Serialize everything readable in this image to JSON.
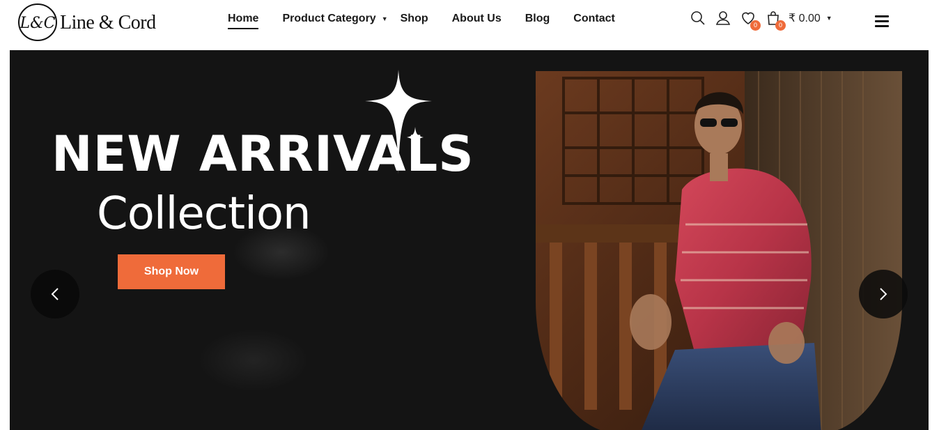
{
  "brand": {
    "logo_monogram": "L&C",
    "name": "Line & Cord"
  },
  "nav": {
    "items": [
      {
        "label": "Home",
        "active": true
      },
      {
        "label": "Product Category",
        "has_dropdown": true
      },
      {
        "label": "Shop"
      },
      {
        "label": "About Us"
      },
      {
        "label": "Blog"
      },
      {
        "label": "Contact"
      }
    ]
  },
  "header_icons": {
    "search": "search-icon",
    "account": "user-icon",
    "wishlist": {
      "icon": "heart-icon",
      "count": "0"
    },
    "cart": {
      "icon": "shopping-bag-icon",
      "count": "0",
      "total": "₹ 0.00"
    },
    "menu": "hamburger-menu-icon"
  },
  "hero": {
    "headline": "NEW ARRIVALS",
    "subheadline": "Collection",
    "cta_label": "Shop Now",
    "prev_icon": "chevron-left-icon",
    "next_icon": "chevron-right-icon",
    "decor_icon": "sparkle-star-icon"
  },
  "colors": {
    "accent": "#ef6b3a",
    "hero_background": "#141414",
    "text_dark": "#1a1a1a",
    "white": "#ffffff"
  }
}
